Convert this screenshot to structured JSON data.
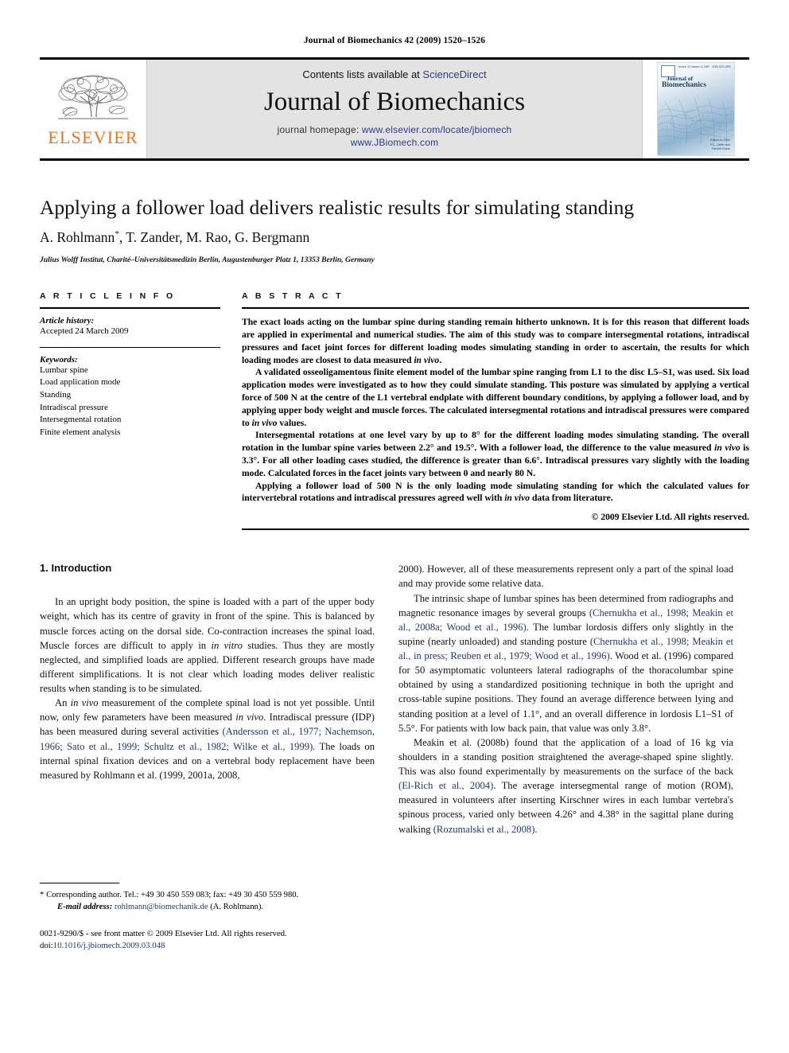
{
  "running_head": "Journal of Biomechanics 42 (2009) 1520–1526",
  "masthead": {
    "publisher_name": "ELSEVIER",
    "contents_prefix": "Contents lists available at ",
    "contents_link": "ScienceDirect",
    "journal_title": "Journal of Biomechanics",
    "homepage_prefix": "journal homepage: ",
    "homepage_url": "www.elsevier.com/locate/jbiomech",
    "homepage_url2": "www.JBiomech.com",
    "cover": {
      "volume_text": "Volume 42 Number 11 2009",
      "issn_text": "ISSN 0021-9290",
      "title_line1": "Journal of",
      "title_line2": "Biomechanics",
      "footer_line1": "Editors-in-Chief",
      "footer_line2": "R.L. Lieber and",
      "footer_line3": "Farshid Guilak"
    }
  },
  "article": {
    "title": "Applying a follower load delivers realistic results for simulating standing",
    "authors": "A. Rohlmann",
    "authors_rest": ", T. Zander, M. Rao, G. Bergmann",
    "corresponding_marker": "*",
    "affiliation": "Julius Wolff Institut, Charité–Universitätsmedizin Berlin, Augustenburger Platz 1, 13353 Berlin, Germany"
  },
  "article_info": {
    "heading": "A R T I C L E   I N F O",
    "history_label": "Article history:",
    "history_value": "Accepted 24 March 2009",
    "keywords_label": "Keywords:",
    "keywords": [
      "Lumbar spine",
      "Load application mode",
      "Standing",
      "Intradiscal pressure",
      "Intersegmental rotation",
      "Finite element analysis"
    ]
  },
  "abstract": {
    "heading": "A B S T R A C T",
    "paragraphs": [
      "The exact loads acting on the lumbar spine during standing remain hitherto unknown. It is for this reason that different loads are applied in experimental and numerical studies. The aim of this study was to compare intersegmental rotations, intradiscal pressures and facet joint forces for different loading modes simulating standing in order to ascertain, the results for which loading modes are closest to data measured in vivo.",
      "A validated osseoligamentous finite element model of the lumbar spine ranging from L1 to the disc L5–S1, was used. Six load application modes were investigated as to how they could simulate standing. This posture was simulated by applying a vertical force of 500 N at the centre of the L1 vertebral endplate with different boundary conditions, by applying a follower load, and by applying upper body weight and muscle forces. The calculated intersegmental rotations and intradiscal pressures were compared to in vivo values.",
      "Intersegmental rotations at one level vary by up to 8° for the different loading modes simulating standing. The overall rotation in the lumbar spine varies between 2.2° and 19.5°. With a follower load, the difference to the value measured in vivo is 3.3°. For all other loading cases studied, the difference is greater than 6.6°. Intradiscal pressures vary slightly with the loading mode. Calculated forces in the facet joints vary between 0 and nearly 80 N.",
      "Applying a follower load of 500 N is the only loading mode simulating standing for which the calculated values for intervertebral rotations and intradiscal pressures agreed well with in vivo data from literature."
    ],
    "copyright": "© 2009 Elsevier Ltd. All rights reserved."
  },
  "introduction": {
    "section_title": "1.  Introduction",
    "left_paragraphs": [
      "In an upright body position, the spine is loaded with a part of the upper body weight, which has its centre of gravity in front of the spine. This is balanced by muscle forces acting on the dorsal side. Co-contraction increases the spinal load. Muscle forces are difficult to apply in in vitro studies. Thus they are mostly neglected, and simplified loads are applied. Different research groups have made different simplifications. It is not clear which loading modes deliver realistic results when standing is to be simulated.",
      "An in vivo measurement of the complete spinal load is not yet possible. Until now, only few parameters have been measured in vivo. Intradiscal pressure (IDP) has been measured during several activities (Andersson et al., 1977; Nachemson, 1966; Sato et al., 1999; Schultz et al., 1982; Wilke et al., 1999). The loads on internal spinal fixation devices and on a vertebral body replacement have been measured by Rohlmann et al. (1999, 2001a, 2008,"
    ],
    "right_paragraphs": [
      "2000). However, all of these measurements represent only a part of the spinal load and may provide some relative data.",
      "The intrinsic shape of lumbar spines has been determined from radiographs and magnetic resonance images by several groups (Chernukha et al., 1998; Meakin et al., 2008a; Wood et al., 1996). The lumbar lordosis differs only slightly in the supine (nearly unloaded) and standing posture (Chernukha et al., 1998; Meakin et al., in press; Reuben et al., 1979; Wood et al., 1996). Wood et al. (1996) compared for 50 asymptomatic volunteers lateral radiographs of the thoracolumbar spine obtained by using a standardized positioning technique in both the upright and cross-table supine positions. They found an average difference between lying and standing position at a level of 1.1°, and an overall difference in lordosis L1–S1 of 5.5°. For patients with low back pain, that value was only 3.8°.",
      "Meakin et al. (2008b) found that the application of a load of 16 kg via shoulders in a standing position straightened the average-shaped spine slightly. This was also found experimentally by measurements on the surface of the back (El-Rich et al., 2004). The average intersegmental range of motion (ROM), measured in volunteers after inserting Kirschner wires in each lumbar vertebra's spinous process, varied only between 4.26° and 4.38° in the sagittal plane during walking (Rozumalski et al., 2008)."
    ]
  },
  "footnotes": {
    "corresponding": "Corresponding author. Tel.: +49 30 450 559 083; fax: +49 30 450 559 980.",
    "email_label": "E-mail address:",
    "email_value": "rohlmann@biomechanik.de",
    "email_suffix": "(A. Rohlmann).",
    "issn_line": "0021-9290/$ - see front matter © 2009 Elsevier Ltd. All rights reserved.",
    "doi_label": "doi:",
    "doi_value": "10.1016/j.jbiomech.2009.03.048"
  },
  "colors": {
    "link_blue": "#1e3a78",
    "sciencedirect_blue": "#2b3a8f",
    "elsevier_orange": "#E87722"
  }
}
